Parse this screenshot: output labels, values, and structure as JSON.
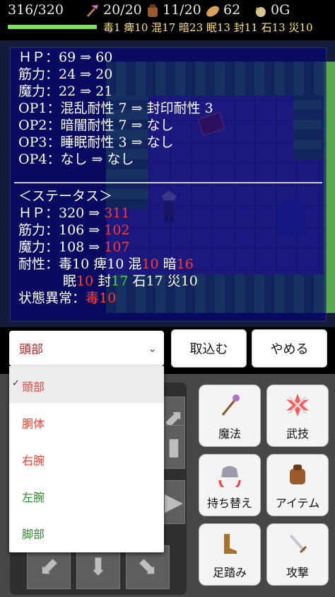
{
  "top": {
    "hp": "316/320",
    "hp_fraction": 0.9875,
    "pickaxe": "20/20",
    "bag": "11/20",
    "bread": "62",
    "gold": "0G",
    "statuses": "毒1 痺10 混17 暗23 眠13 封11 石13 災10"
  },
  "compare": {
    "lines": [
      "ＨＰ：69 ⇒ 60",
      "筋力：24 ⇒ 20",
      "魔力：22 ⇒ 21",
      "OP1：混乱耐性 7 ⇒ 封印耐性 3",
      "OP2：暗闇耐性 7 ⇒ なし",
      "OP3：睡眠耐性 3 ⇒ なし",
      "OP4：なし ⇒ なし"
    ],
    "status_title": "＜ステータス＞",
    "hp_label": "ＨＰ：320 ⇒ ",
    "hp_new": "311",
    "str_label": "筋力：106 ⇒ ",
    "str_new": "102",
    "mag_label": "魔力：108 ⇒ ",
    "mag_new": "107",
    "res_label": "耐性：毒10 痺10 混",
    "res_konran": "10",
    "res_an_label": " 暗",
    "res_an": "16",
    "res2_label": "眠",
    "res2_nemuri": "10",
    "res2_fu_label": " 封",
    "res2_fu": "17",
    "res2_rest": " 石17 災10",
    "abn_label": "状態異常：",
    "abn_value": "毒10"
  },
  "buttons": {
    "select_value": "頭部",
    "take_in": "取込む",
    "cancel": "やめる"
  },
  "dropdown": {
    "options": [
      "頭部",
      "胴体",
      "右腕",
      "左腕",
      "脚部"
    ]
  },
  "actions": {
    "magic": "魔法",
    "skill": "武技",
    "swap": "持ち替え",
    "item": "アイテム",
    "step": "足踏み",
    "attack": "攻撃"
  },
  "colors": {
    "hp_bar": "#7ee05e",
    "status_text": "#ffe46a",
    "worse": "#ff3b30",
    "better": "#59d05a"
  }
}
